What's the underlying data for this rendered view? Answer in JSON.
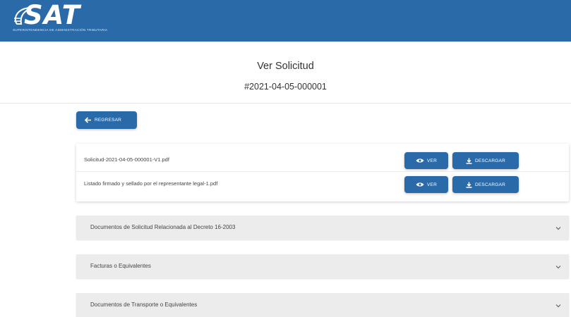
{
  "header": {
    "logo_text": "SAT",
    "logo_subtitle": "SUPERINTENDENCIA DE ADMINISTRACIÓN TRIBUTARIA",
    "brand_color": "#2a6aa8"
  },
  "page": {
    "title": "Ver Solicitud",
    "request_number": "#2021-04-05-000001"
  },
  "back_button": {
    "label": "REGRESAR",
    "icon": "arrow-left-icon"
  },
  "files": [
    {
      "name": "Solicitud-2021-04-05-000001-V1.pdf",
      "view_label": "VER",
      "download_label": "DESCARGAR"
    },
    {
      "name": "Listado firmado y sellado por el representante legal-1.pdf",
      "view_label": "VER",
      "download_label": "DESCARGAR"
    }
  ],
  "sections": [
    {
      "title": "Documentos de Solicitud Relacionada al Decreto 16-2003",
      "icon": "chevron-down-icon"
    },
    {
      "title": "Facturas o Equivalentes",
      "icon": "chevron-down-icon"
    },
    {
      "title": "Documentos de Transporte o Equivalentes",
      "icon": "chevron-down-icon"
    }
  ]
}
